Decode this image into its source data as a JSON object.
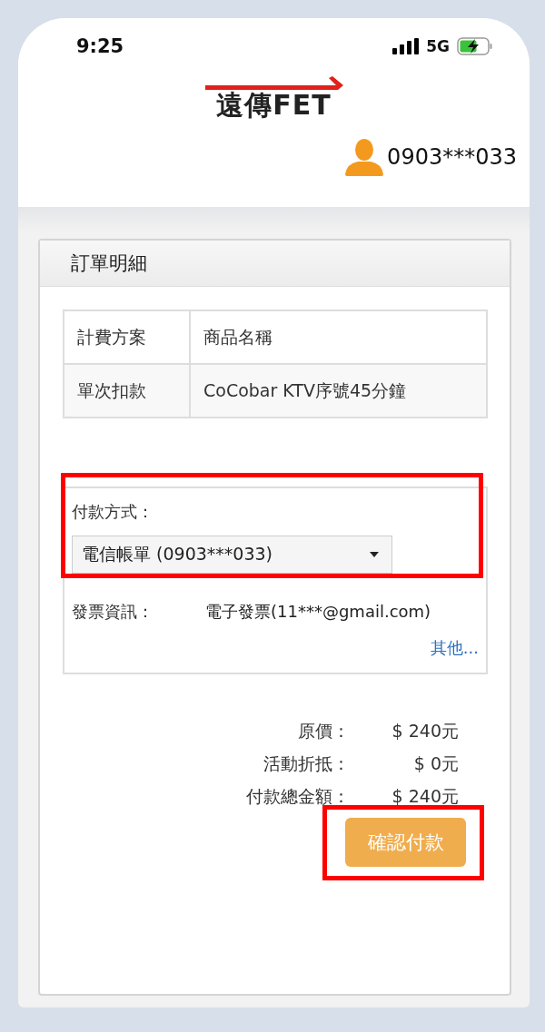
{
  "status_bar": {
    "time": "9:25",
    "network": "5G"
  },
  "header": {
    "logo": "遠傳FET",
    "user": "0903***033"
  },
  "order": {
    "title": "訂單明細",
    "table": {
      "columns": [
        "計費方案",
        "商品名稱"
      ],
      "rows": [
        [
          "單次扣款",
          "CoCobar KTV序號45分鐘"
        ]
      ]
    },
    "payment_method": {
      "label": "付款方式：",
      "value": "電信帳單 (0903***033)",
      "highlighted": true
    },
    "invoice": {
      "label": "發票資訊：",
      "value": "電子發票(11***@gmail.com)",
      "link": "其他..."
    },
    "totals": [
      {
        "label": "原價：",
        "value": "$ 240元"
      },
      {
        "label": "活動折抵：",
        "value": "$ 0元"
      },
      {
        "label": "付款總金額：",
        "value": "$ 240元"
      }
    ],
    "confirm_button": {
      "label": "確認付款",
      "highlighted": true
    }
  }
}
